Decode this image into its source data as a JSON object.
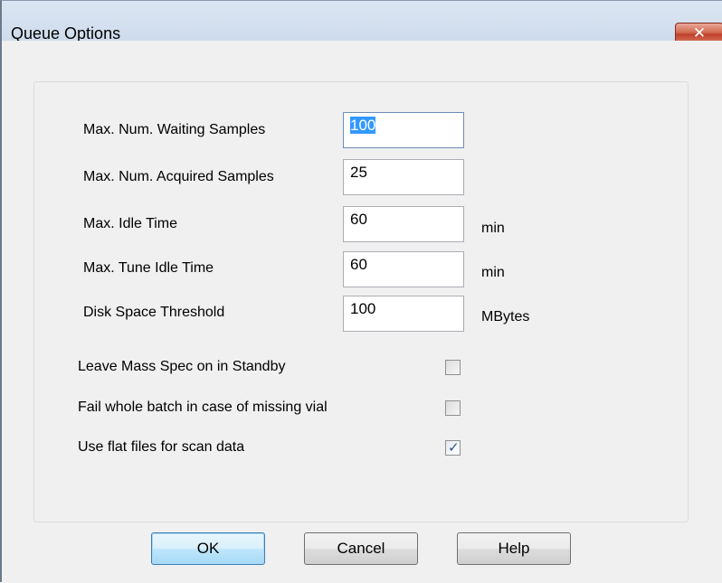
{
  "window": {
    "title": "Queue Options",
    "close_label": "✕"
  },
  "fields": [
    {
      "label": "Max. Num. Waiting Samples",
      "value": "100",
      "unit": ""
    },
    {
      "label": "Max. Num. Acquired Samples",
      "value": "25",
      "unit": ""
    },
    {
      "label": "Max. Idle Time",
      "value": "60",
      "unit": "min"
    },
    {
      "label": "Max. Tune Idle Time",
      "value": "60",
      "unit": "min"
    },
    {
      "label": "Disk Space Threshold",
      "value": "100",
      "unit": "MBytes"
    }
  ],
  "checkboxes": [
    {
      "label": "Leave Mass Spec on in Standby",
      "checked": false
    },
    {
      "label": "Fail whole batch in case of missing vial",
      "checked": false
    },
    {
      "label": "Use flat files for scan data",
      "checked": true
    }
  ],
  "buttons": {
    "ok": "OK",
    "cancel": "Cancel",
    "help": "Help"
  },
  "colors": {
    "selection": "#3399ff",
    "checkmark": "#2b4f8a",
    "close_button": "#c0402a"
  }
}
